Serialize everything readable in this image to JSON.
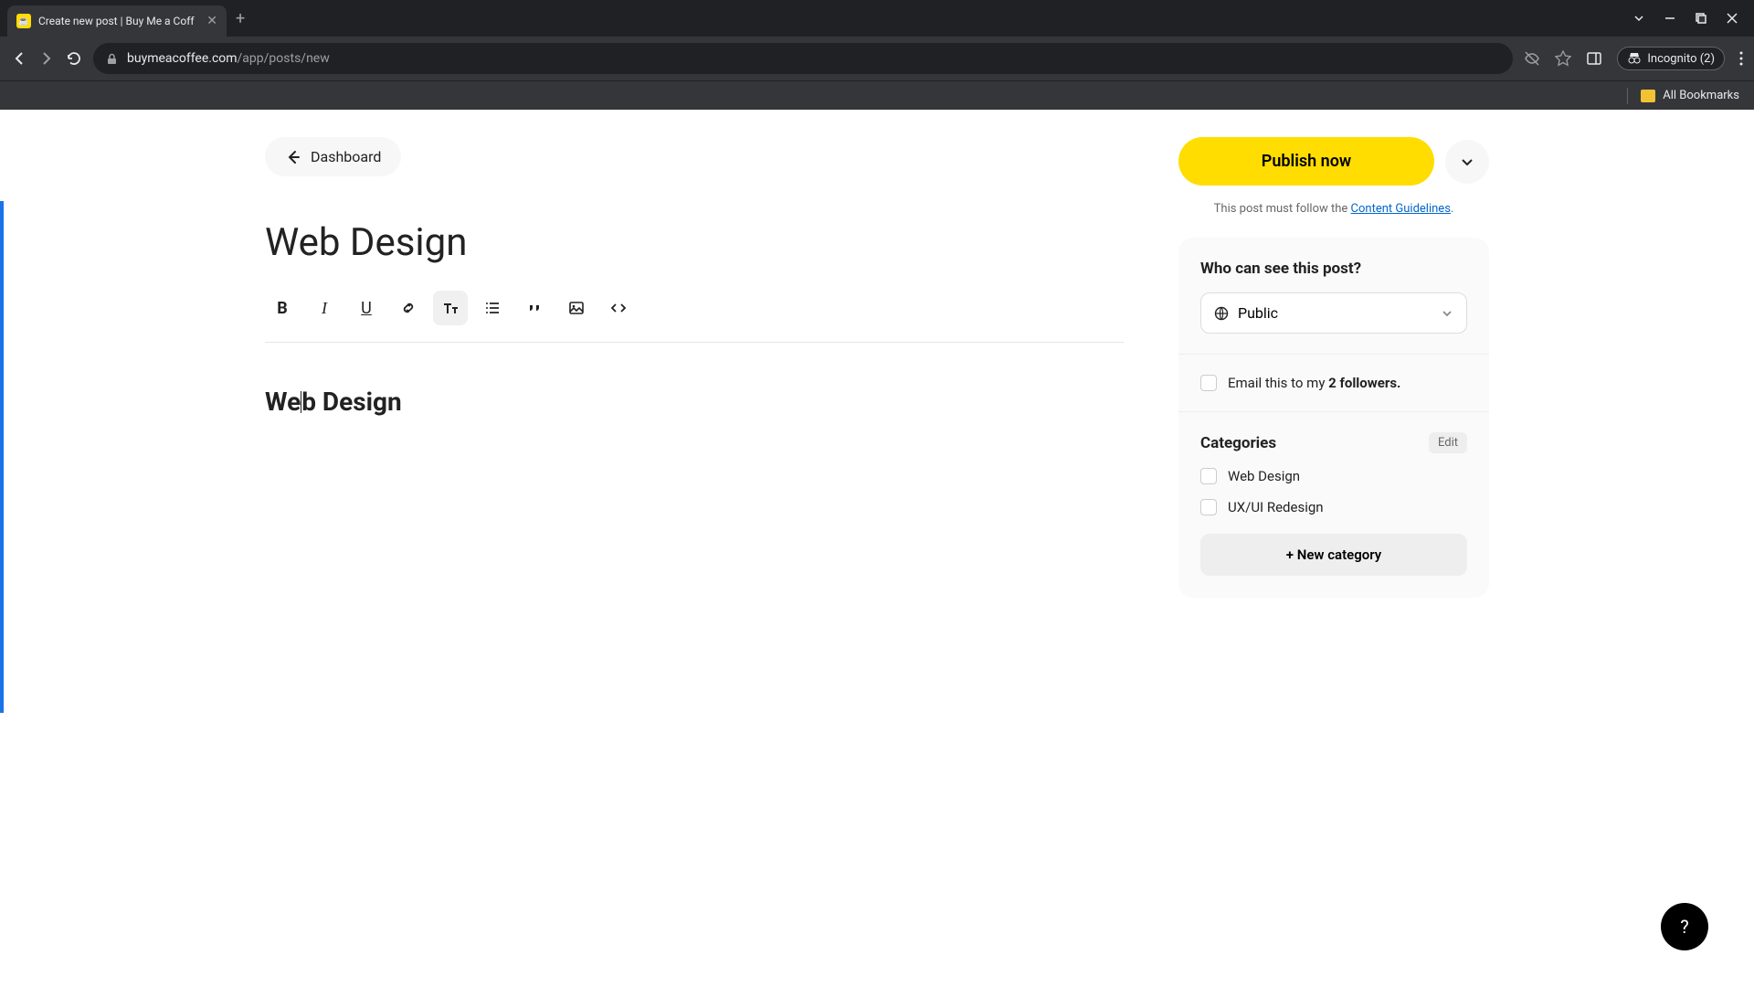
{
  "browser": {
    "tab_title": "Create new post | Buy Me a Coff",
    "url_host": "buymeacoffee.com",
    "url_path": "/app/posts/new",
    "incognito_label": "Incognito (2)",
    "bookmarks_label": "All Bookmarks"
  },
  "header": {
    "back_label": "Dashboard"
  },
  "post": {
    "title": "Web Design",
    "body_heading": "Web Design"
  },
  "toolbar": {
    "bold": "B",
    "italic": "I",
    "underline": "U"
  },
  "publish": {
    "button_label": "Publish now",
    "note_prefix": "This post must follow the ",
    "note_link": "Content Guidelines"
  },
  "visibility": {
    "title": "Who can see this post?",
    "selected": "Public"
  },
  "email": {
    "prefix": "Email this to my ",
    "count": "2 followers."
  },
  "categories": {
    "title": "Categories",
    "edit_label": "Edit",
    "items": [
      "Web Design",
      "UX/UI Redesign"
    ],
    "new_label": "+ New category"
  },
  "help": {
    "label": "?"
  }
}
